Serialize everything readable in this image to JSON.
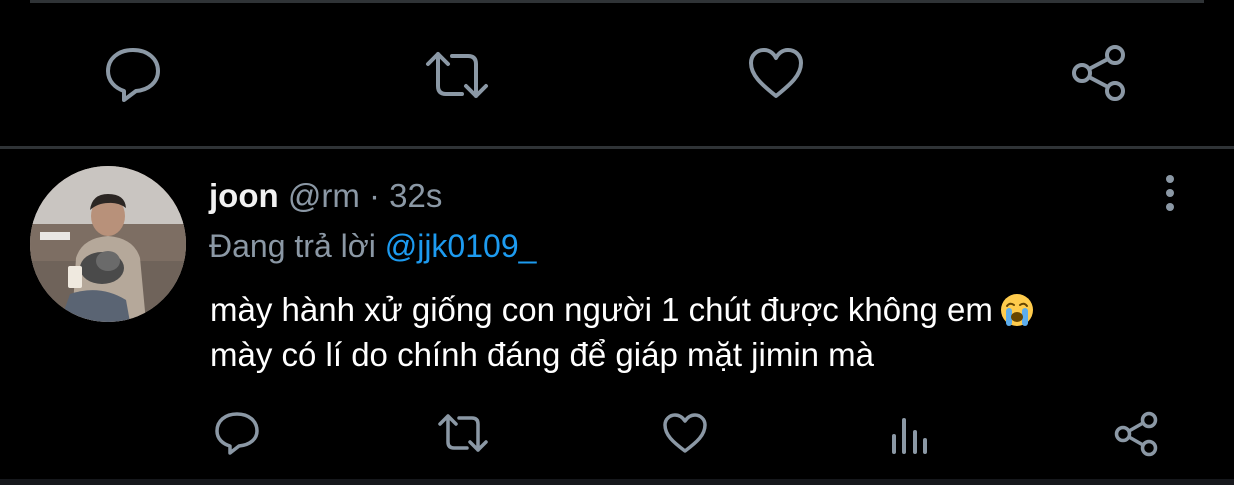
{
  "colors": {
    "background": "#000000",
    "text": "#ffffff",
    "secondary_text": "#8b98a5",
    "mention": "#1d9bf0",
    "action_icon": "#8b98a5",
    "divider": "#2f3336"
  },
  "previous_tweet": {
    "actions": [
      "reply-icon",
      "retweet-icon",
      "like-icon",
      "share-icon"
    ]
  },
  "tweet": {
    "display_name": "joon",
    "handle": "@rm",
    "separator": "·",
    "time": "32s",
    "reply_prefix": "Đang trả lời",
    "reply_to": "@jjk0109_",
    "text_line1": "mày hành xử giống con người 1 chút được không em",
    "text_line2": "mày có lí do chính đáng để giáp mặt jimin mà",
    "emoji": "loudly-crying-face",
    "actions": [
      "reply-icon",
      "retweet-icon",
      "like-icon",
      "analytics-icon",
      "share-icon"
    ]
  }
}
